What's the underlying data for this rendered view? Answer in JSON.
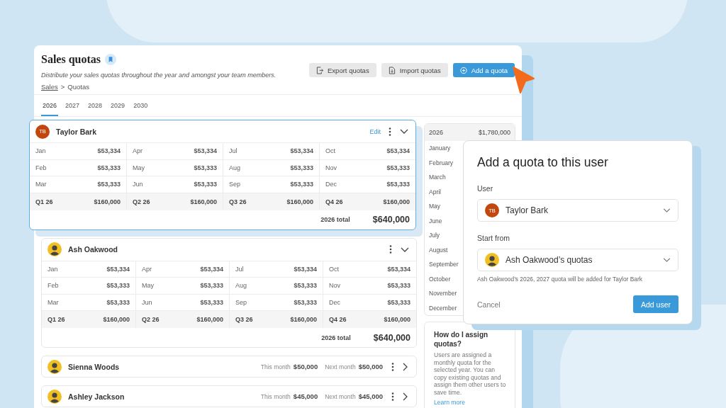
{
  "header": {
    "title": "Sales quotas",
    "description": "Distribute your sales quotas throughout the year and amongst your team members.",
    "breadcrumb": {
      "items": [
        {
          "label": "Sales",
          "link": true
        },
        {
          "label": "Quotas",
          "link": false
        }
      ],
      "separator": ">"
    },
    "buttons": [
      {
        "label": "Export quotas",
        "kind": "export"
      },
      {
        "label": "Import quotas",
        "kind": "import"
      },
      {
        "label": "Add a quota",
        "kind": "add"
      }
    ]
  },
  "tabs": [
    {
      "label": "2026",
      "selected": true
    },
    {
      "label": "2027",
      "selected": false
    },
    {
      "label": "2028",
      "selected": false
    },
    {
      "label": "2029",
      "selected": false
    },
    {
      "label": "2030",
      "selected": false
    }
  ],
  "quota_cards": [
    {
      "name": "Taylor Bark",
      "avatar": {
        "kind": "initials",
        "initials": "TB"
      },
      "selected": true,
      "expanded": true,
      "edit_label": "Edit",
      "quarters": [
        {
          "label": "Q1 26",
          "total": "$160,000",
          "months": [
            {
              "label": "Jan",
              "amount": "$53,334"
            },
            {
              "label": "Feb",
              "amount": "$53,333"
            },
            {
              "label": "Mar",
              "amount": "$53,333"
            }
          ]
        },
        {
          "label": "Q2 26",
          "total": "$160,000",
          "months": [
            {
              "label": "Apr",
              "amount": "$53,334"
            },
            {
              "label": "May",
              "amount": "$53,333"
            },
            {
              "label": "Jun",
              "amount": "$53,333"
            }
          ]
        },
        {
          "label": "Q3 26",
          "total": "$160,000",
          "months": [
            {
              "label": "Jul",
              "amount": "$53,334"
            },
            {
              "label": "Aug",
              "amount": "$53,333"
            },
            {
              "label": "Sep",
              "amount": "$53,333"
            }
          ]
        },
        {
          "label": "Q4 26",
          "total": "$160,000",
          "months": [
            {
              "label": "Oct",
              "amount": "$53,334"
            },
            {
              "label": "Nov",
              "amount": "$53,333"
            },
            {
              "label": "Dec",
              "amount": "$53,333"
            }
          ]
        }
      ],
      "total_label": "2026 total",
      "total": "$640,000"
    },
    {
      "name": "Ash Oakwood",
      "avatar": {
        "kind": "photo"
      },
      "selected": false,
      "expanded": true,
      "quarters": [
        {
          "label": "Q1 26",
          "total": "$160,000",
          "months": [
            {
              "label": "Jan",
              "amount": "$53,334"
            },
            {
              "label": "Feb",
              "amount": "$53,333"
            },
            {
              "label": "Mar",
              "amount": "$53,333"
            }
          ]
        },
        {
          "label": "Q2 26",
          "total": "$160,000",
          "months": [
            {
              "label": "Apr",
              "amount": "$53,334"
            },
            {
              "label": "May",
              "amount": "$53,333"
            },
            {
              "label": "Jun",
              "amount": "$53,333"
            }
          ]
        },
        {
          "label": "Q3 26",
          "total": "$160,000",
          "months": [
            {
              "label": "Jul",
              "amount": "$53,334"
            },
            {
              "label": "Aug",
              "amount": "$53,333"
            },
            {
              "label": "Sep",
              "amount": "$53,333"
            }
          ]
        },
        {
          "label": "Q4 26",
          "total": "$160,000",
          "months": [
            {
              "label": "Oct",
              "amount": "$53,334"
            },
            {
              "label": "Nov",
              "amount": "$53,333"
            },
            {
              "label": "Dec",
              "amount": "$53,333"
            }
          ]
        }
      ],
      "total_label": "2026 total",
      "total": "$640,000"
    },
    {
      "name": "Sienna Woods",
      "avatar": {
        "kind": "photo"
      },
      "selected": false,
      "expanded": false,
      "this_month_label": "This month",
      "this_month": "$50,000",
      "next_month_label": "Next month",
      "next_month": "$50,000"
    },
    {
      "name": "Ashley Jackson",
      "avatar": {
        "kind": "photo"
      },
      "selected": false,
      "expanded": false,
      "this_month_label": "This month",
      "this_month": "$45,000",
      "next_month_label": "Next month",
      "next_month": "$45,000"
    }
  ],
  "year_summary": {
    "year": "2026",
    "total": "$1,780,000",
    "months": [
      "January",
      "February",
      "March",
      "April",
      "May",
      "June",
      "July",
      "August",
      "September",
      "October",
      "November",
      "December"
    ]
  },
  "help": {
    "title": "How do I assign quotas?",
    "text": "Users are assigned a monthly quota for the selected year. You can copy existing quotas and assign them other users to save time.",
    "link": "Learn more"
  },
  "dialog": {
    "title": "Add a quota to this user",
    "fields": [
      {
        "label": "User",
        "value": "Taylor Bark",
        "avatar": {
          "kind": "initials",
          "initials": "TB"
        }
      },
      {
        "label": "Start from",
        "value": "Ash Oakwood’s quotas",
        "avatar": {
          "kind": "photo"
        }
      }
    ],
    "hint": "Ash Oakwood’s 2026, 2027 quota will be added for Taylor Bark",
    "cancel": "Cancel",
    "submit": "Add user"
  }
}
